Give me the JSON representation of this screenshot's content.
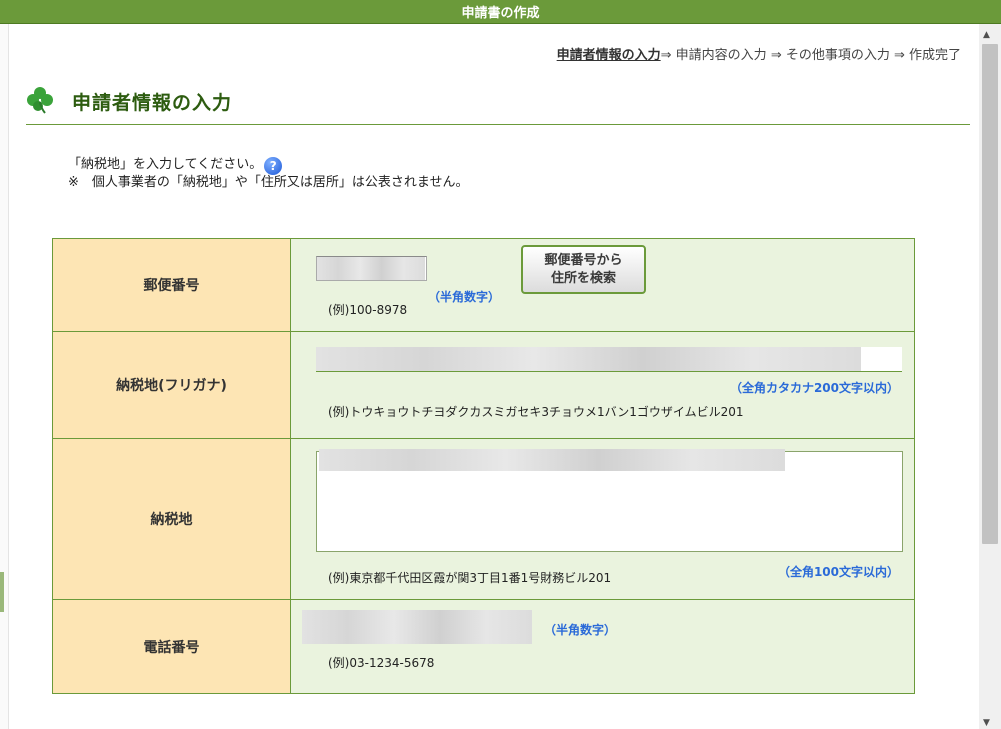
{
  "window": {
    "title": "申請書の作成"
  },
  "steps": {
    "current": "申請者情報の入力",
    "rest": "⇒ 申請内容の入力 ⇒ その他事項の入力 ⇒ 作成完了"
  },
  "heading": {
    "title": "申請者情報の入力",
    "icon": "clover-icon"
  },
  "intro": {
    "line1": "「納税地」を入力してください。",
    "line2": "※　個人事業者の「納税地」や「住所又は居所」は公表されません。"
  },
  "form": {
    "postal": {
      "label": "郵便番号",
      "value": "",
      "hint": "（半角数字）",
      "example": "(例)100-8978",
      "button": "郵便番号から\n住所を検索"
    },
    "kana": {
      "label": "納税地(フリガナ)",
      "value": "",
      "hint": "（全角カタカナ200文字以内）",
      "example": "(例)トウキョウトチヨダクカスミガセキ3チョウメ1バン1ゴウザイムビル201"
    },
    "address": {
      "label": "納税地",
      "value": "",
      "hint": "（全角100文字以内）",
      "example": "(例)東京都千代田区霞が関3丁目1番1号財務ビル201"
    },
    "phone": {
      "label": "電話番号",
      "value": "",
      "hint": "（半角数字）",
      "example": "(例)03-1234-5678"
    }
  },
  "colors": {
    "titlebar": "#6b9a3a",
    "label_bg": "#fde5b4",
    "cell_bg": "#eaf3de",
    "hint": "#2a6ad8",
    "heading": "#2d5c10"
  }
}
